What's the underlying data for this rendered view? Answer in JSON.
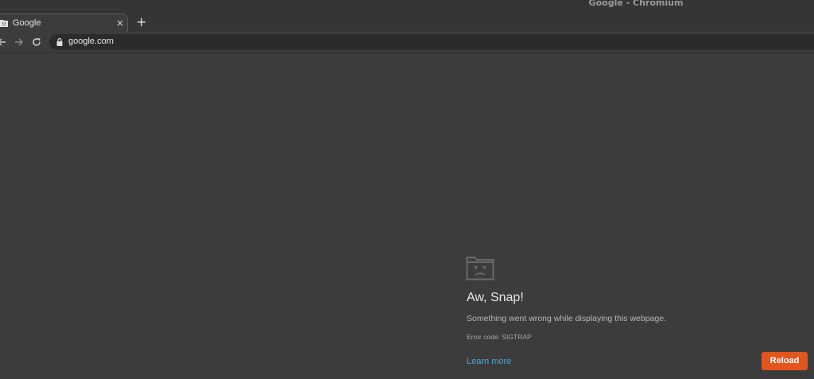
{
  "window": {
    "title": "Google - Chromium"
  },
  "tab": {
    "title": "Google",
    "favicon": "sad-tab-icon",
    "close_glyph": "×"
  },
  "newtab": {
    "glyph": "+"
  },
  "toolbar": {
    "back_icon": "back-arrow-icon",
    "forward_icon": "forward-arrow-icon",
    "reload_icon": "reload-icon",
    "url": "google.com"
  },
  "sad_tab": {
    "icon": "sad-folder-icon",
    "heading": "Aw, Snap!",
    "message": "Something went wrong while displaying this webpage.",
    "error_code": "Error code: SIGTRAP",
    "learn_more": "Learn more",
    "reload": "Reload"
  },
  "colors": {
    "background": "#3c3c3c",
    "reload_button": "#e2551f",
    "link": "#4ea6dc"
  }
}
